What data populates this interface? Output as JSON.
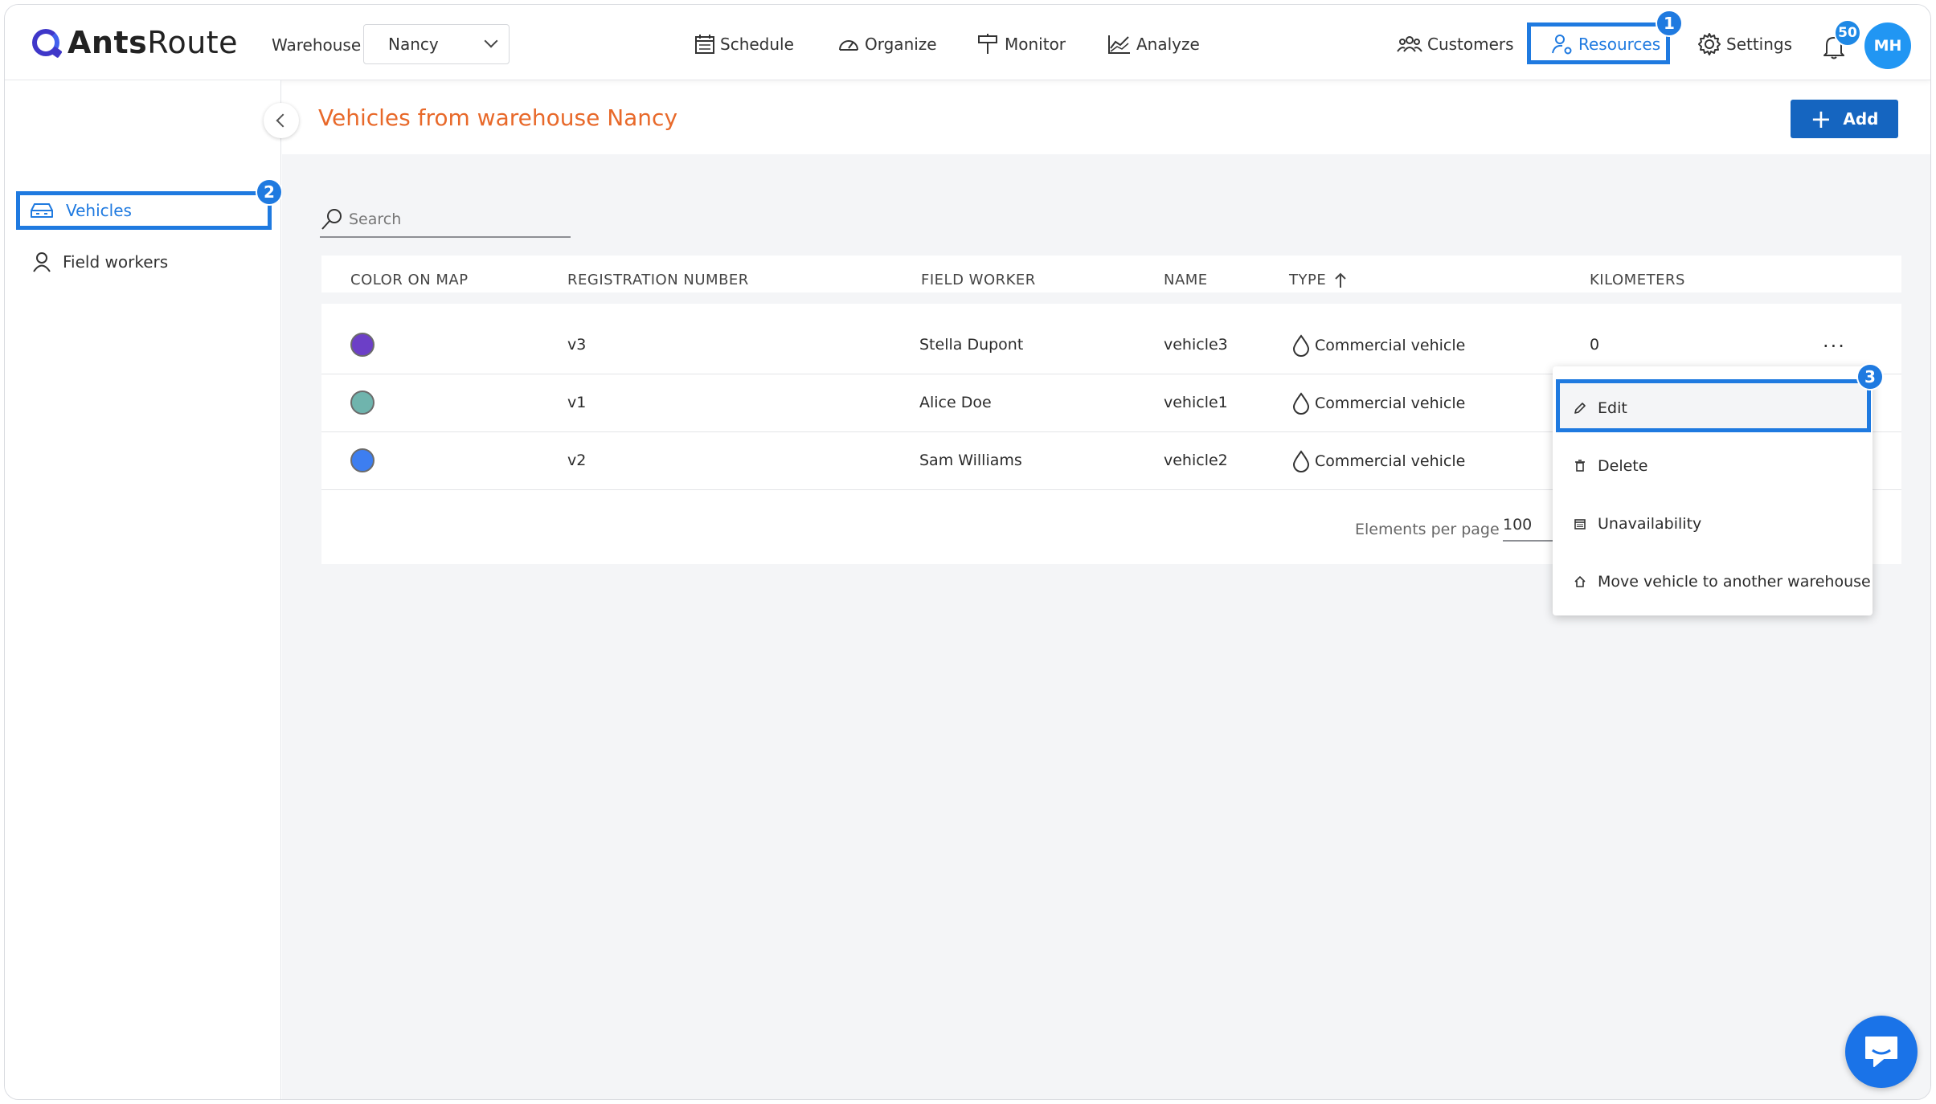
{
  "app": {
    "logo_bold": "Ants",
    "logo_light": "Route"
  },
  "header": {
    "warehouse_label": "Warehouse",
    "warehouse_value": "Nancy",
    "nav": {
      "schedule": "Schedule",
      "organize": "Organize",
      "monitor": "Monitor",
      "analyze": "Analyze",
      "customers": "Customers",
      "resources": "Resources",
      "settings": "Settings"
    },
    "notifications_count": "50",
    "avatar_initials": "MH"
  },
  "steps": {
    "one": "1",
    "two": "2",
    "three": "3"
  },
  "sidebar": {
    "items": [
      {
        "label": "Vehicles"
      },
      {
        "label": "Field workers"
      }
    ]
  },
  "page": {
    "title": "Vehicles from warehouse Nancy",
    "add_label": "Add",
    "search_placeholder": "Search"
  },
  "table": {
    "headers": [
      "COLOR ON MAP",
      "REGISTRATION NUMBER",
      "FIELD WORKER",
      "NAME",
      "TYPE",
      "KILOMETERS"
    ],
    "rows": [
      {
        "color": "#6c3fc7",
        "registration": "v3",
        "field_worker": "Stella Dupont",
        "name": "vehicle3",
        "type": "Commercial vehicle",
        "kilometers": "0"
      },
      {
        "color": "#6fb4ad",
        "registration": "v1",
        "field_worker": "Alice Doe",
        "name": "vehicle1",
        "type": "Commercial vehicle",
        "kilometers": ""
      },
      {
        "color": "#3d7ef0",
        "registration": "v2",
        "field_worker": "Sam Williams",
        "name": "vehicle2",
        "type": "Commercial vehicle",
        "kilometers": ""
      }
    ],
    "more": "...",
    "pager_label": "Elements per page",
    "pager_value": "100"
  },
  "menu": {
    "edit": "Edit",
    "delete": "Delete",
    "unavailability": "Unavailability",
    "move": "Move vehicle to another warehouse"
  },
  "colors": {
    "accent": "#1f7ae0",
    "title": "#e8692a",
    "add_button": "#1565c0"
  }
}
